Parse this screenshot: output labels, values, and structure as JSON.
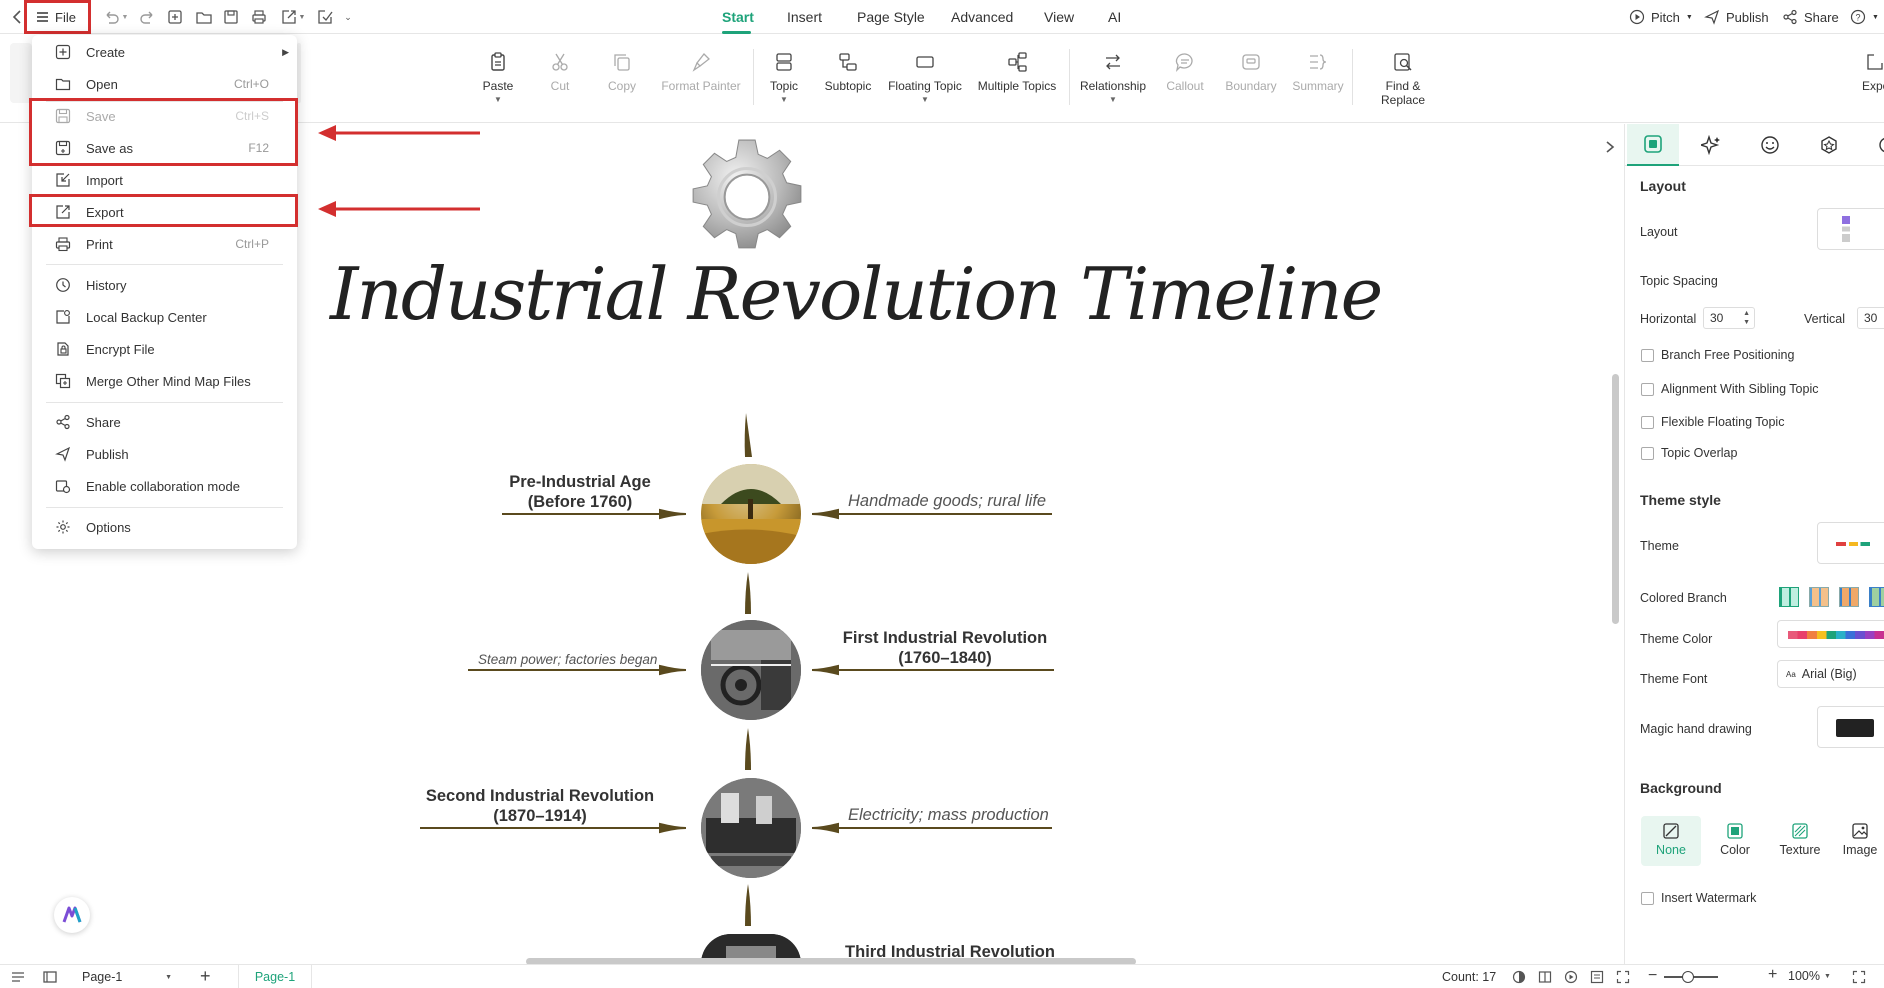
{
  "topbar": {
    "file_label": "File",
    "tabs": [
      {
        "label": "Start",
        "active": true
      },
      {
        "label": "Insert"
      },
      {
        "label": "Page Style"
      },
      {
        "label": "Advanced"
      },
      {
        "label": "View"
      },
      {
        "label": "AI"
      }
    ],
    "right": {
      "pitch": "Pitch",
      "publish": "Publish",
      "share": "Share"
    }
  },
  "ribbon": {
    "buttons": [
      {
        "label": "Paste",
        "icon": "clipboard-icon",
        "enabled": true,
        "dropdown": true
      },
      {
        "label": "Cut",
        "icon": "scissors-icon",
        "enabled": false
      },
      {
        "label": "Copy",
        "icon": "copy-icon",
        "enabled": false
      },
      {
        "label": "Format Painter",
        "icon": "brush-icon",
        "enabled": false
      },
      {
        "label": "Topic",
        "icon": "topic-icon",
        "enabled": true,
        "dropdown": true
      },
      {
        "label": "Subtopic",
        "icon": "subtopic-icon",
        "enabled": true
      },
      {
        "label": "Floating Topic",
        "icon": "floating-topic-icon",
        "enabled": true,
        "dropdown": true
      },
      {
        "label": "Multiple Topics",
        "icon": "multiple-topics-icon",
        "enabled": true
      },
      {
        "label": "Relationship",
        "icon": "relationship-icon",
        "enabled": true,
        "dropdown": true
      },
      {
        "label": "Callout",
        "icon": "callout-icon",
        "enabled": false
      },
      {
        "label": "Boundary",
        "icon": "boundary-icon",
        "enabled": false
      },
      {
        "label": "Summary",
        "icon": "summary-icon",
        "enabled": false
      },
      {
        "label": "Find & Replace",
        "icon": "find-replace-icon",
        "enabled": true
      }
    ],
    "export_partial": "Expo"
  },
  "file_menu": {
    "items": [
      {
        "label": "Create",
        "shortcut": "",
        "icon": "plus-square-icon",
        "enabled": true,
        "submenu": true
      },
      {
        "label": "Open",
        "shortcut": "Ctrl+O",
        "icon": "folder-icon",
        "enabled": true
      },
      {
        "label": "Save",
        "shortcut": "Ctrl+S",
        "icon": "save-icon",
        "enabled": false
      },
      {
        "label": "Save as",
        "shortcut": "F12",
        "icon": "save-as-icon",
        "enabled": true
      },
      {
        "label": "Import",
        "shortcut": "",
        "icon": "import-icon",
        "enabled": true
      },
      {
        "label": "Export",
        "shortcut": "",
        "icon": "export-icon",
        "enabled": true
      },
      {
        "label": "Print",
        "shortcut": "Ctrl+P",
        "icon": "printer-icon",
        "enabled": true
      },
      {
        "label": "History",
        "shortcut": "",
        "icon": "history-icon",
        "enabled": true
      },
      {
        "label": "Local Backup Center",
        "shortcut": "",
        "icon": "backup-icon",
        "enabled": true
      },
      {
        "label": "Encrypt File",
        "shortcut": "",
        "icon": "lock-icon",
        "enabled": true
      },
      {
        "label": "Merge Other Mind Map Files",
        "shortcut": "",
        "icon": "merge-icon",
        "enabled": true
      },
      {
        "label": "Share",
        "shortcut": "",
        "icon": "share-icon",
        "enabled": true
      },
      {
        "label": "Publish",
        "shortcut": "",
        "icon": "publish-icon",
        "enabled": true
      },
      {
        "label": "Enable collaboration mode",
        "shortcut": "",
        "icon": "collaboration-icon",
        "enabled": true
      },
      {
        "label": "Options",
        "shortcut": "",
        "icon": "gear-icon",
        "enabled": true
      }
    ]
  },
  "canvas": {
    "title": "Industrial Revolution Timeline",
    "nodes": [
      {
        "title": "Pre-Industrial Age",
        "dates": "(Before 1760)",
        "note": "Handmade goods; rural life"
      },
      {
        "title": "First Industrial Revolution",
        "dates": "(1760–1840)",
        "note": "Steam power; factories began"
      },
      {
        "title": "Second Industrial Revolution",
        "dates": "(1870–1914)",
        "note": "Electricity; mass production"
      },
      {
        "title": "Third Industrial Revolution",
        "dates": "",
        "note": ""
      }
    ]
  },
  "panel": {
    "layout_heading": "Layout",
    "layout_label": "Layout",
    "topic_spacing": "Topic Spacing",
    "horizontal_label": "Horizontal",
    "horizontal_value": "30",
    "vertical_label": "Vertical",
    "vertical_value": "30",
    "checkboxes": [
      {
        "label": "Branch Free Positioning",
        "checked": false
      },
      {
        "label": "Alignment With Sibling Topic",
        "checked": false
      },
      {
        "label": "Flexible Floating Topic",
        "checked": false
      },
      {
        "label": "Topic Overlap",
        "checked": false
      }
    ],
    "theme_style_heading": "Theme style",
    "theme_label": "Theme",
    "colored_branch_label": "Colored Branch",
    "theme_color_label": "Theme Color",
    "theme_font_label": "Theme Font",
    "theme_font_value": "Arial (Big)",
    "magic_label": "Magic hand drawing",
    "background_heading": "Background",
    "bg_options": [
      {
        "label": "None",
        "active": true
      },
      {
        "label": "Color"
      },
      {
        "label": "Texture"
      },
      {
        "label": "Image"
      }
    ],
    "watermark_label": "Insert Watermark"
  },
  "status": {
    "page_select": "Page-1",
    "page_tab": "Page-1",
    "count": "Count: 17",
    "zoom": "100%"
  },
  "colors": {
    "accent": "#1ea37a",
    "highlight": "#d32f2f",
    "branch": "#5a4a1e"
  }
}
